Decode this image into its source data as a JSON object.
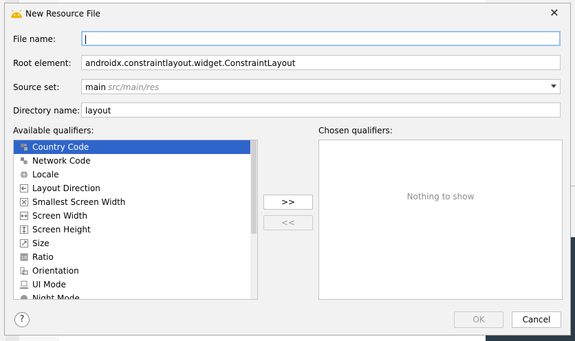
{
  "dialog": {
    "title": "New Resource File",
    "close_glyph": "✕"
  },
  "form": {
    "file_name": {
      "label": "File name:",
      "value": ""
    },
    "root_element": {
      "label": "Root element:",
      "value": "androidx.constraintlayout.widget.ConstraintLayout"
    },
    "source_set": {
      "label": "Source set:",
      "value": "main",
      "hint": "src/main/res"
    },
    "directory_name": {
      "label": "Directory name:",
      "value": "layout"
    }
  },
  "available": {
    "label": "Available qualifiers:",
    "items": [
      {
        "label": "Country Code",
        "icon": "country-code-icon",
        "selected": true
      },
      {
        "label": "Network Code",
        "icon": "network-code-icon",
        "selected": false
      },
      {
        "label": "Locale",
        "icon": "globe-icon",
        "selected": false
      },
      {
        "label": "Layout Direction",
        "icon": "arrow-left-icon",
        "selected": false
      },
      {
        "label": "Smallest Screen Width",
        "icon": "expand-icon",
        "selected": false
      },
      {
        "label": "Screen Width",
        "icon": "horizontal-arrows-icon",
        "selected": false
      },
      {
        "label": "Screen Height",
        "icon": "vertical-arrows-icon",
        "selected": false
      },
      {
        "label": "Size",
        "icon": "resize-icon",
        "selected": false
      },
      {
        "label": "Ratio",
        "icon": "ratio-icon",
        "selected": false
      },
      {
        "label": "Orientation",
        "icon": "orientation-icon",
        "selected": false
      },
      {
        "label": "UI Mode",
        "icon": "ui-mode-icon",
        "selected": false
      },
      {
        "label": "Night Mode",
        "icon": "night-mode-icon",
        "selected": false
      }
    ]
  },
  "chosen": {
    "label": "Chosen qualifiers:",
    "empty_text": "Nothing to show"
  },
  "buttons": {
    "add": ">>",
    "remove": "<<",
    "ok": "OK",
    "cancel": "Cancel",
    "help": "?"
  },
  "colors": {
    "selection": "#2f65ca",
    "focus_border": "#97c3ef",
    "android_green": "#f0b400"
  }
}
